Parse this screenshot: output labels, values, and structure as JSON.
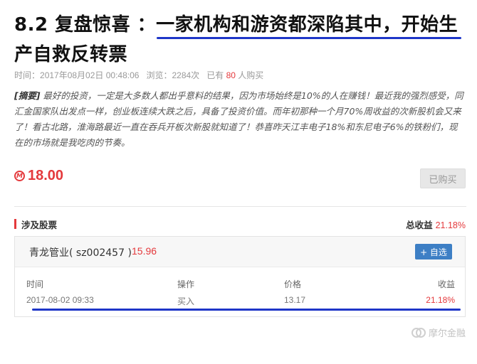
{
  "article": {
    "title_plain": "8.2 复盘惊喜 ：",
    "title_highlight1": "一家机构和游资都深陷其中，开始生",
    "title_highlight2": "产自救反转票",
    "meta": {
      "time_label": "时间：",
      "time_value": "2017年08月02日 00:48:06",
      "views_label": "浏览：",
      "views_value": "2284次",
      "bought_prefix": "已有",
      "bought_count": "80",
      "bought_suffix": "人购买"
    },
    "summary": {
      "tag": "[摘要]",
      "text": " 最好的投资，一定是大多数人都出乎意料的结果，因为市场始终是10%的人在赚钱！最近我的强烈感受，同汇金国家队出发点一样，创业板连续大跌之后，具备了投资价值。而年初那种一个月70%周收益的次新股机会又来了！看古北路，淮海路最近一直在吞兵开板次新股就知道了！恭喜昨天江丰电子18%和东尼电子6%的铁粉们，现在的市场就是我吃肉的节奏。"
    },
    "price": {
      "coin_symbol": "M",
      "value": "18.00",
      "button_label": "已购买"
    }
  },
  "stocks_section": {
    "title": "涉及股票",
    "total_label": "总收益",
    "total_value": "21.18%",
    "stock": {
      "name": "青龙管业( sz002457 )",
      "price": "15.96",
      "add_button": "+ 自选",
      "columns": [
        "时间",
        "操作",
        "价格",
        "收益"
      ],
      "rows": [
        [
          "2017-08-02 09:33",
          "买入",
          "13.17",
          "21.18%"
        ]
      ]
    }
  },
  "watermark": {
    "text": "摩尔金融"
  },
  "colors": {
    "accent_red": "#e4393c",
    "highlight_blue": "#1e36c8",
    "button_blue": "#3d7fc5"
  }
}
